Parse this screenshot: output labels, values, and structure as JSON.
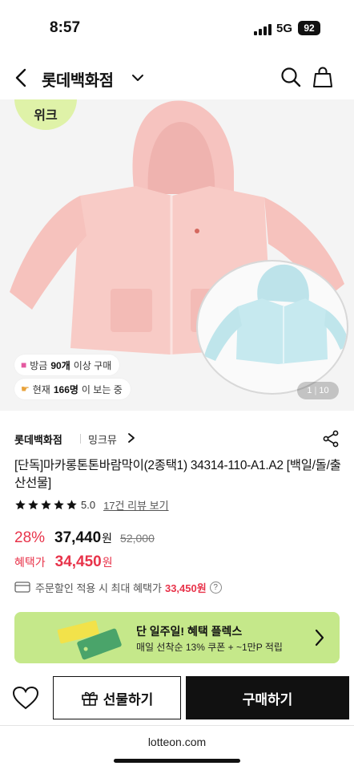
{
  "status_bar": {
    "time": "8:57",
    "network": "5G",
    "battery": "92"
  },
  "header": {
    "title": "롯데백화점"
  },
  "product_image": {
    "badge_text": "위크",
    "stats": [
      {
        "icon": "shopping-bag-icon",
        "prefix": "방금 ",
        "count": "90개",
        "suffix": "이상 구매"
      },
      {
        "icon": "pointing-hand-icon",
        "prefix": "현재 ",
        "count": "166명",
        "suffix": "이 보는 중"
      }
    ],
    "counter_current": "1",
    "counter_total": "10"
  },
  "seller": {
    "store": "롯데백화점",
    "brand": "밍크뮤"
  },
  "product": {
    "name": "[단독]마카롱톤톤바람막이(2종택1) 34314-110-A1.A2 [백일/돌/출산선물]",
    "rating": "5.0",
    "rating_stars": 5,
    "review_link": "17건 리뷰 보기"
  },
  "price": {
    "discount": "28%",
    "price": "37,440",
    "won": "원",
    "original": "52,000",
    "benefit_label": "혜택가",
    "benefit_price": "34,450",
    "benefit_won": "원"
  },
  "order_benefit": {
    "text": "주문할인 적용 시 최대 혜택가",
    "max_price": "33,450원"
  },
  "promo": {
    "title": "단 일주일! 혜택 플렉스",
    "subtitle": "매일 선착순 13% 쿠폰 + ~1만P 적립"
  },
  "bottom_bar": {
    "gift_label": "선물하기",
    "buy_label": "구매하기"
  },
  "footer": {
    "url": "lotteon.com"
  },
  "colors": {
    "accent_red": "#e8334a",
    "promo_green": "#c5e88a",
    "badge_green": "#dff2a8"
  }
}
